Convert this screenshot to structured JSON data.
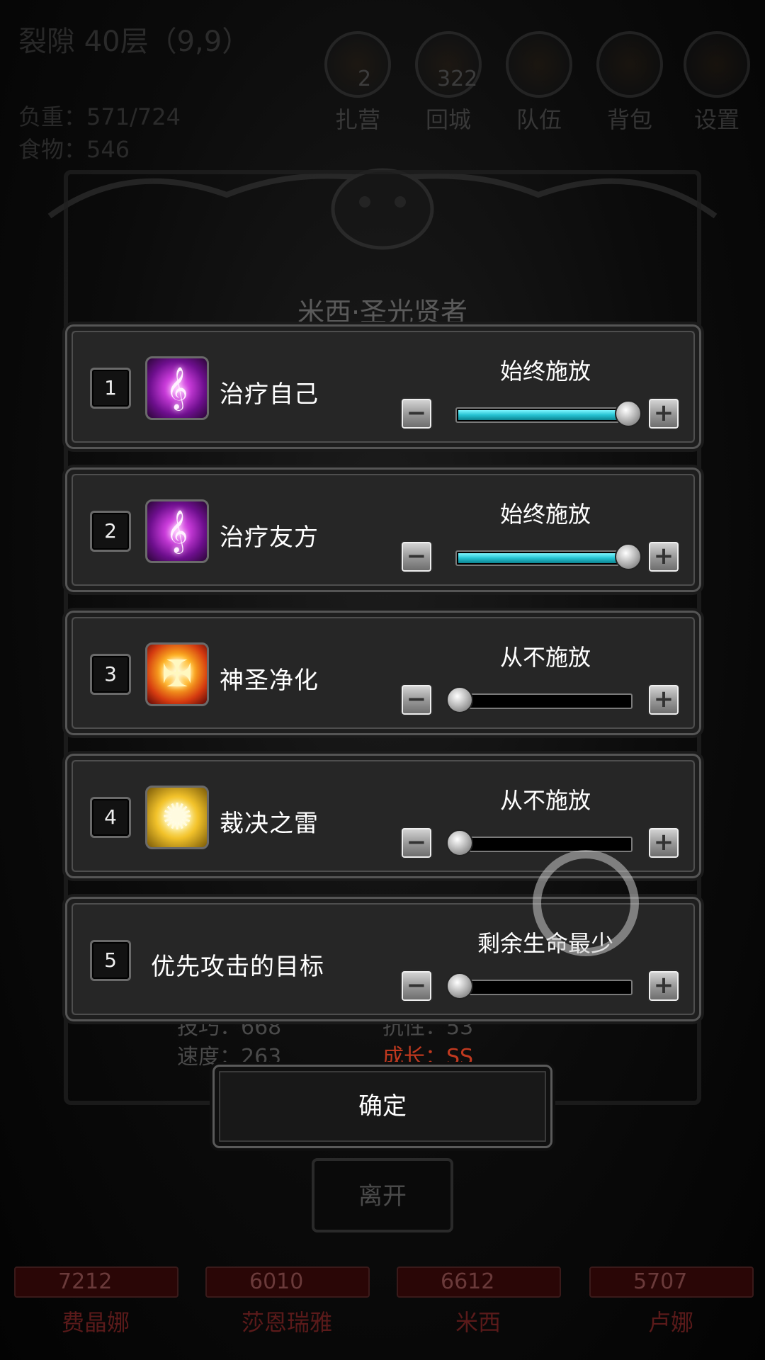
{
  "hud": {
    "title": "裂隙 40层（9,9）",
    "load": "负重：571/724",
    "food": "食物：546",
    "buttons": [
      {
        "label": "扎营",
        "badge": "2",
        "icon": "camp-icon"
      },
      {
        "label": "回城",
        "badge": "322",
        "icon": "return-icon"
      },
      {
        "label": "队伍",
        "badge": "",
        "icon": "team-icon"
      },
      {
        "label": "背包",
        "badge": "",
        "icon": "bag-icon"
      },
      {
        "label": "设置",
        "badge": "",
        "icon": "gear-icon"
      }
    ]
  },
  "hero_name": "米西·圣光贤者",
  "stats": {
    "skill": "技巧：668",
    "resist": "抗性：53",
    "speed": "速度：263",
    "growth": "成长：SS"
  },
  "leave_label": "离开",
  "party": [
    {
      "hp": "7212",
      "name": "费晶娜"
    },
    {
      "hp": "6010",
      "name": "莎恩瑞雅"
    },
    {
      "hp": "6612",
      "name": "米西"
    },
    {
      "hp": "5707",
      "name": "卢娜"
    }
  ],
  "settings": [
    {
      "num": "1",
      "icon": "heal-icon",
      "label": "治疗自己",
      "mode": "始终施放",
      "level": 1.0
    },
    {
      "num": "2",
      "icon": "heal-icon",
      "label": "治疗友方",
      "mode": "始终施放",
      "level": 1.0
    },
    {
      "num": "3",
      "icon": "holy-purify-icon",
      "label": "神圣净化",
      "mode": "从不施放",
      "level": 0.0
    },
    {
      "num": "4",
      "icon": "judgment-thunder-icon",
      "label": "裁决之雷",
      "mode": "从不施放",
      "level": 0.0
    },
    {
      "num": "5",
      "icon": "",
      "label": "优先攻击的目标",
      "mode": "剩余生命最少",
      "level": 0.0
    }
  ],
  "confirm_label": "确定",
  "colors": {
    "slider_fill": "#25c2d2",
    "growth": "#c0391f"
  }
}
